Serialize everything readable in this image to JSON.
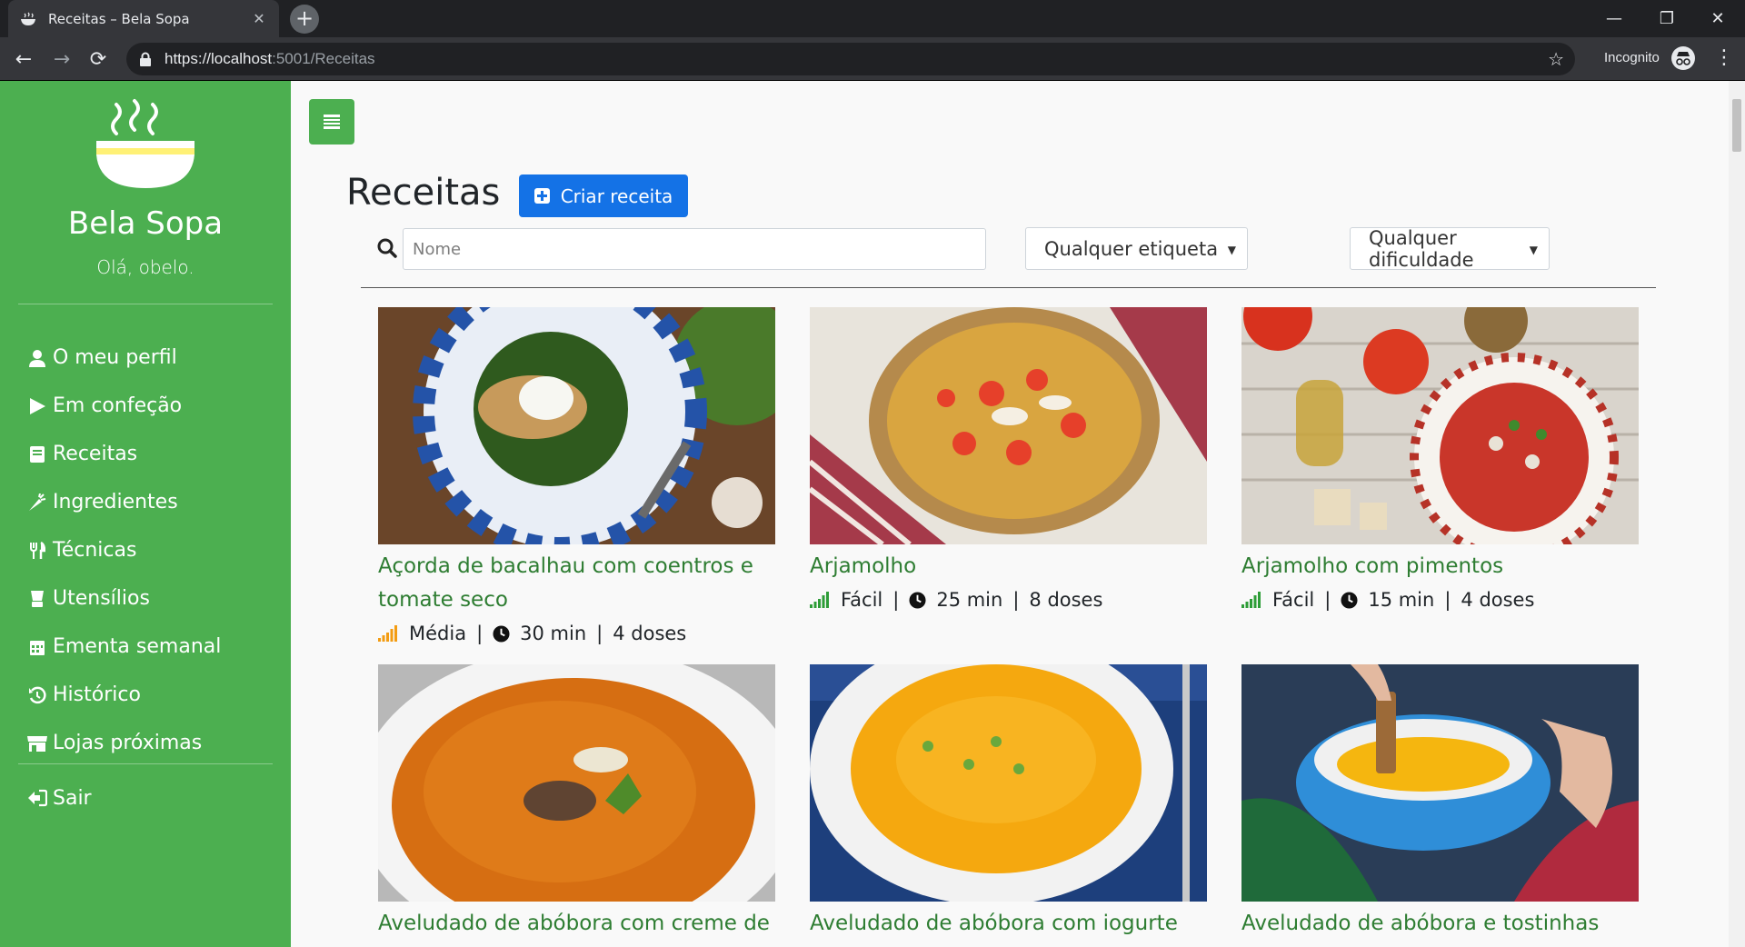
{
  "browser": {
    "tab_title": "Receitas – Bela Sopa",
    "url_main": "https://localhost",
    "url_rest": ":5001/Receitas",
    "profile_label": "Incognito"
  },
  "sidebar": {
    "brand": "Bela Sopa",
    "greeting": "Olá, obelo.",
    "items": [
      {
        "label": "O meu perfil",
        "icon": "user-icon"
      },
      {
        "label": "Em confeção",
        "icon": "play-icon"
      },
      {
        "label": "Receitas",
        "icon": "book-icon"
      },
      {
        "label": "Ingredientes",
        "icon": "carrot-icon"
      },
      {
        "label": "Técnicas",
        "icon": "utensils-icon"
      },
      {
        "label": "Utensílios",
        "icon": "blender-icon"
      },
      {
        "label": "Ementa semanal",
        "icon": "calendar-icon"
      },
      {
        "label": "Histórico",
        "icon": "history-icon"
      },
      {
        "label": "Lojas próximas",
        "icon": "store-icon"
      }
    ],
    "logout": "Sair"
  },
  "main": {
    "title": "Receitas",
    "create_button": "Criar receita",
    "search_placeholder": "Nome",
    "tag_filter": "Qualquer etiqueta",
    "difficulty_filter": "Qualquer dificuldade",
    "recipes": [
      {
        "name": "Açorda de bacalhau com coentros e tomate seco",
        "difficulty": "Média",
        "time": "30 min",
        "servings": "4 doses",
        "level_color": "#f39c12"
      },
      {
        "name": "Arjamolho",
        "difficulty": "Fácil",
        "time": "25 min",
        "servings": "8 doses",
        "level_color": "#2e9d38"
      },
      {
        "name": "Arjamolho com pimentos",
        "difficulty": "Fácil",
        "time": "15 min",
        "servings": "4 doses",
        "level_color": "#2e9d38"
      },
      {
        "name": "Aveludado de abóbora com creme de",
        "difficulty": "",
        "time": "",
        "servings": "",
        "level_color": "#2e9d38"
      },
      {
        "name": "Aveludado de abóbora com iogurte",
        "difficulty": "",
        "time": "",
        "servings": "",
        "level_color": "#2e9d38"
      },
      {
        "name": "Aveludado de abóbora e tostinhas",
        "difficulty": "",
        "time": "",
        "servings": "",
        "level_color": "#2e9d38"
      }
    ]
  },
  "colors": {
    "sidebar": "#4caf50",
    "primary": "#1472e6",
    "link": "#2e7d32"
  }
}
